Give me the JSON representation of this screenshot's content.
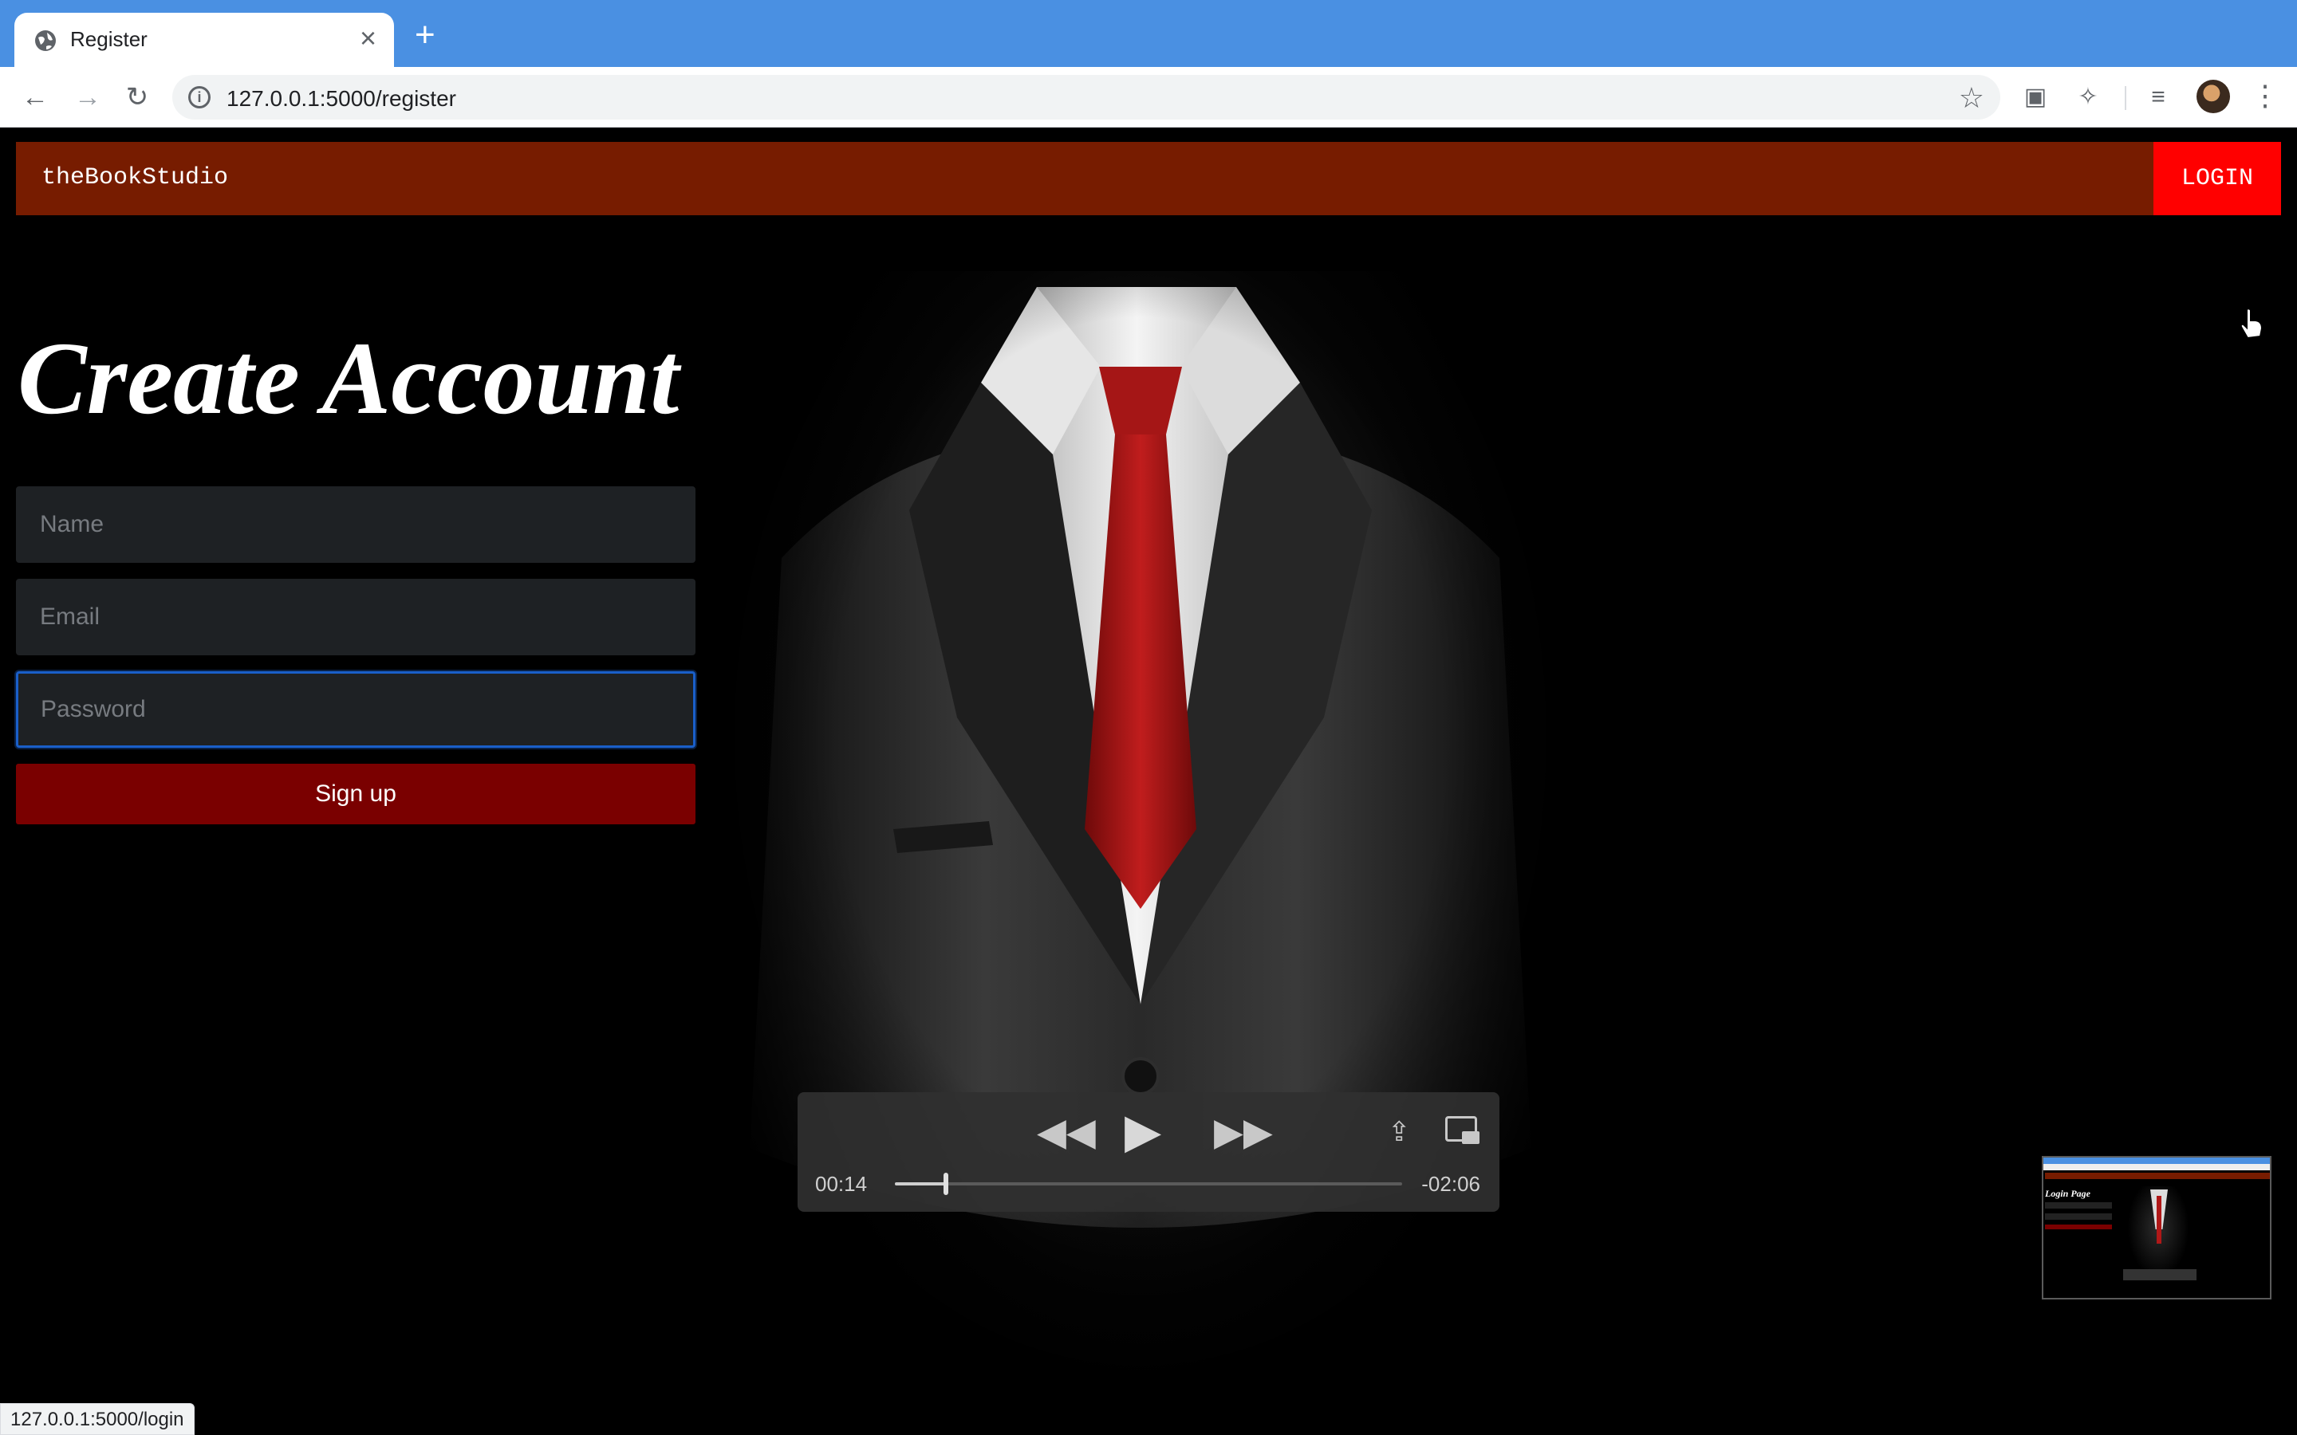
{
  "browser": {
    "tab_title": "Register",
    "url": "127.0.0.1:5000/register",
    "status_url": "127.0.0.1:5000/login"
  },
  "site": {
    "brand": "theBookStudio",
    "login_label": "LOGIN"
  },
  "form": {
    "heading": "Create Account",
    "name_placeholder": "Name",
    "email_placeholder": "Email",
    "password_placeholder": "Password",
    "submit_label": "Sign up"
  },
  "player": {
    "current_time": "00:14",
    "remaining_time": "-02:06",
    "progress": 0.1
  },
  "thumbnail": {
    "title": "Login Page"
  },
  "colors": {
    "tab_strip": "#4a90e2",
    "navbar": "#771c00",
    "login_button": "#ff0000",
    "signup_button": "#7a0000",
    "focus_ring": "#1a5fc9"
  }
}
